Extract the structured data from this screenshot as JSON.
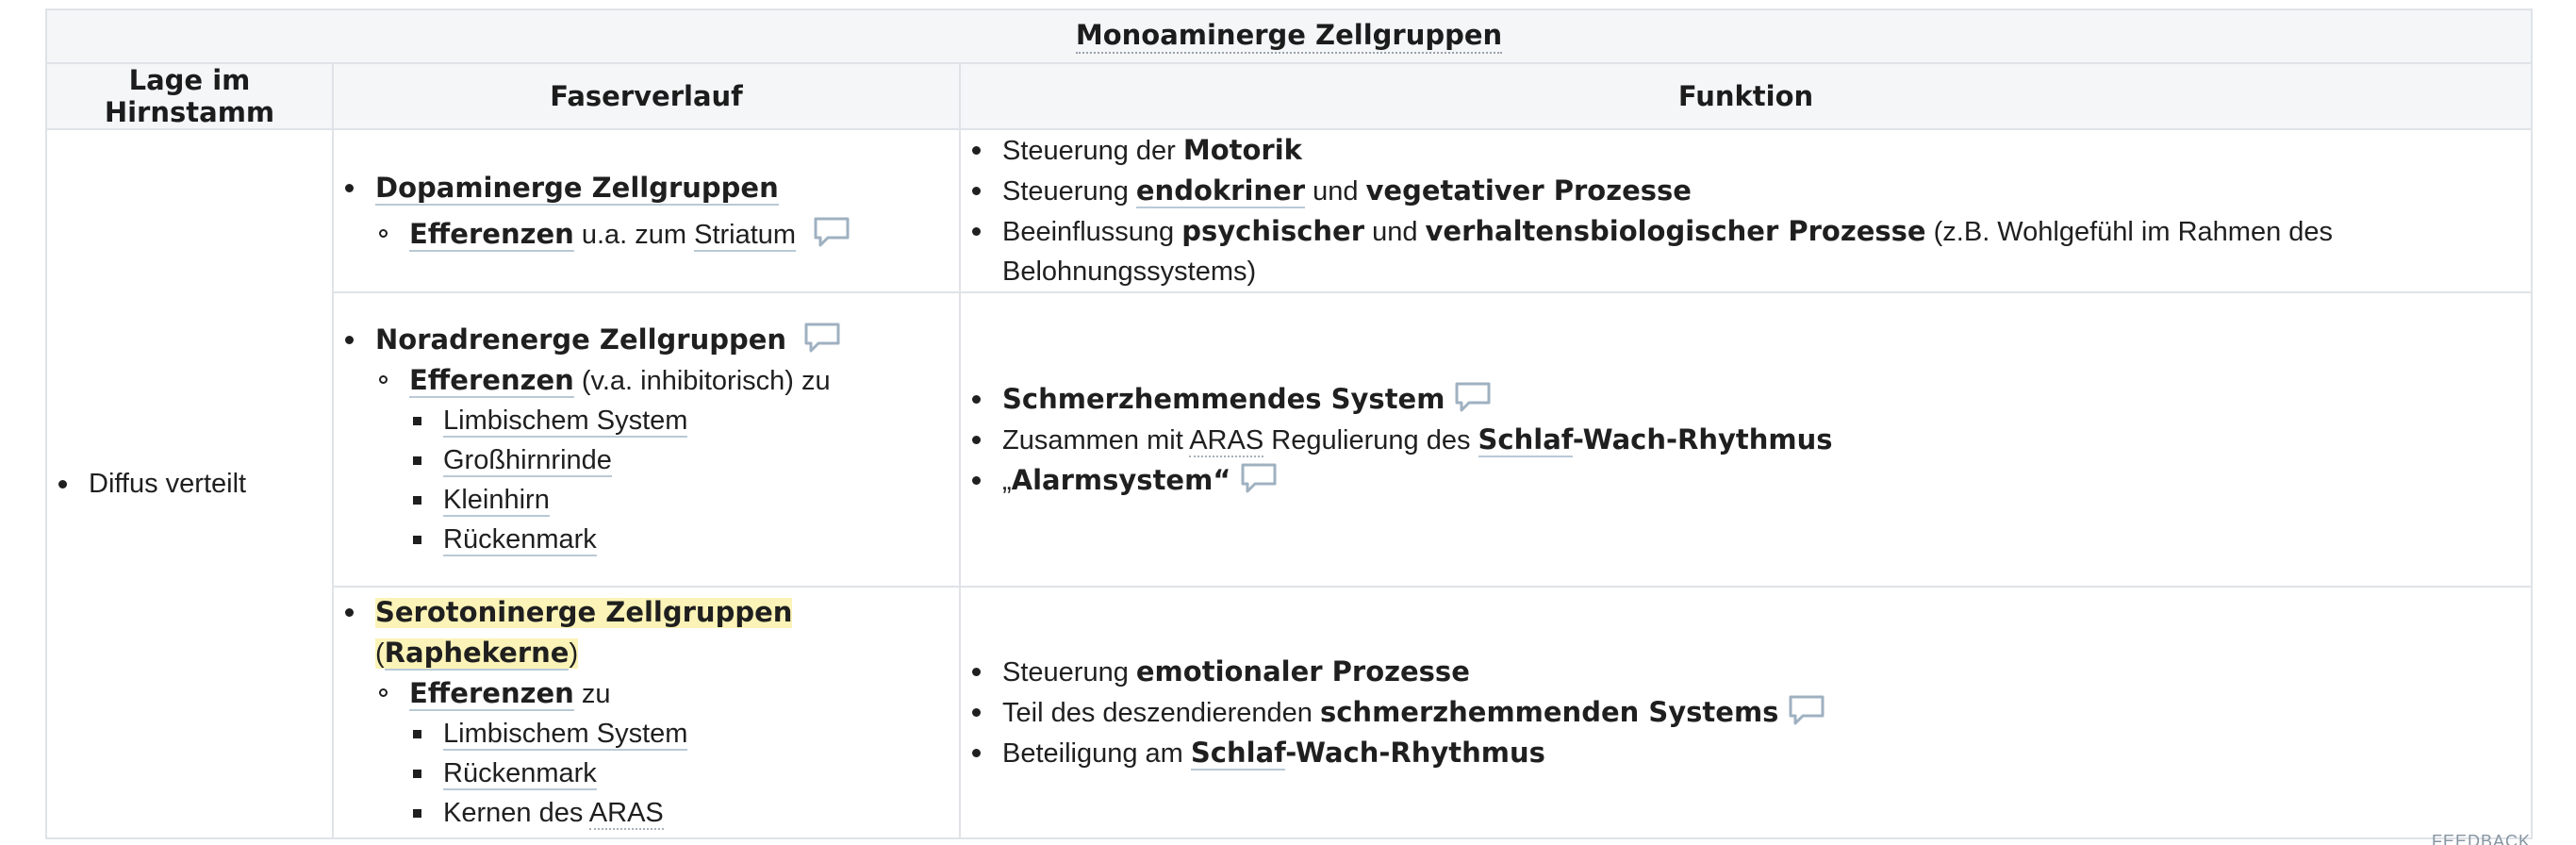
{
  "table": {
    "title": "Monoaminerge Zellgruppen",
    "headers": {
      "lage": "Lage im Hirnstamm",
      "faser": "Faserverlauf",
      "funktion": "Funktion"
    },
    "lage_value": "Diffus verteilt",
    "dopamin": {
      "group": "Dopaminerge Zellgruppen",
      "eff": "Efferenzen",
      "eff_mid": " u.a. zum ",
      "target": "Striatum",
      "f1_pre": "Steuerung der ",
      "f1_b": "Motorik",
      "f2_pre": "Steuerung ",
      "f2_b1": "endokriner",
      "f2_mid": " und ",
      "f2_b2": "vegetativer Prozesse",
      "f3_pre": "Beeinflussung ",
      "f3_b1": "psychischer",
      "f3_mid": " und ",
      "f3_b2": "verhaltensbiologischer Prozesse",
      "f3_post": " (z.B. Wohlgefühl im Rahmen des Belohnungssystems)"
    },
    "noradren": {
      "group": "Noradrenerge Zellgruppen",
      "eff": "Efferenzen",
      "eff_post": " (v.a. inhibitorisch) zu",
      "targets": [
        "Limbischem System",
        "Großhirnrinde",
        "Kleinhirn",
        "Rückenmark"
      ],
      "f1_b": "Schmerzhemmendes System",
      "f2_pre": "Zusammen mit ",
      "f2_link": "ARAS",
      "f2_mid": " Regulierung des ",
      "f2_b1": "Schlaf",
      "f2_b2": "-Wach-Rhythmus",
      "f3_pre": "„",
      "f3_b": "Alarmsystem",
      "f3_post": "“"
    },
    "serot": {
      "group": "Serotoninerge Zellgruppen",
      "group_open": " (",
      "group_b2": "Raphekerne",
      "group_close": ")",
      "eff": "Efferenzen",
      "eff_post": " zu",
      "t1": "Limbischem System",
      "t2": "Rückenmark",
      "t3_pre": "Kernen des ",
      "t3_link": "ARAS",
      "f1_pre": "Steuerung ",
      "f1_b": "emotionaler Prozesse",
      "f2_pre": "Teil des deszendierenden ",
      "f2_b": "schmerzhemmenden Systems",
      "f3_pre": "Beteiligung am ",
      "f3_b1": "Schlaf",
      "f3_b2": "-Wach-Rhythmus"
    }
  },
  "footer_label": "FEEDBACK",
  "colors": {
    "header_bg": "#f4f6f8",
    "border": "#dfe3e8",
    "highlight": "#fbf3b7",
    "comment_icon": "#9fb1c1"
  }
}
